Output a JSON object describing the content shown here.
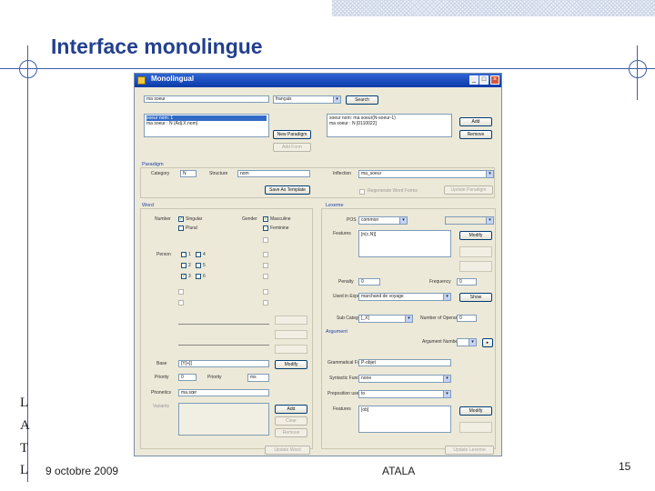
{
  "slide": {
    "title": "Interface monolingue",
    "date": "9 octobre 2009",
    "center": "ATALA",
    "page": "15",
    "side_letters": [
      "L",
      "A",
      "T",
      "L"
    ]
  },
  "window": {
    "title": "Monolingual",
    "min": "_",
    "max": "□",
    "close": "×"
  },
  "top": {
    "word_input": "ma soeur",
    "lang_select": "français",
    "search_btn": "Search",
    "list_left": [
      "soeur nom: 1",
      "ma soeur : N (Adj.X.nom)"
    ],
    "new_paradigm_btn": "New Paradigm",
    "add_form_btn": "Add Form",
    "list_right": [
      "soeur nom: ma soeur(N-soeur-1)",
      "ma soeur : N [0110022]"
    ],
    "add_btn": "Add",
    "remove_btn": "Remove"
  },
  "paradigm": {
    "header": "Paradigm",
    "category_label": "Category",
    "category_value": "N",
    "structure_label": "Structure",
    "structure_value": "nom",
    "save_btn": "Save As Template",
    "inflection_label": "Inflection",
    "inflection_value": "ma_soeur",
    "regenerate_label": "Regenerate Word Forms",
    "update_btn": "Update Paradigm"
  },
  "word": {
    "header": "Word",
    "number_label": "Number",
    "singular": "Singular",
    "plural": "Plural",
    "gender_label": "Gender",
    "masculine": "Masculine",
    "feminine": "Feminine",
    "person_label": "Person",
    "p1": "1",
    "p2": "2",
    "p3": "3",
    "p4": "4",
    "p5": "5",
    "p6": "6",
    "base_label": "Base",
    "base_value": "[Y[+]]",
    "priority_label": "Priority",
    "priority_value": "0",
    "priority_select": "ms",
    "modify_btn": "Modify",
    "phonetics_label": "Phonetics",
    "phonetics_value": "ma.sœr",
    "variants_label": "Variants",
    "add_btn": "Add",
    "clear_btn": "Clear",
    "remove_btn": "Remove",
    "update_btn": "Update Word"
  },
  "lexeme": {
    "header": "Lexeme",
    "pos_label": "POS",
    "pos_value": "common",
    "features_label": "Features",
    "features_value": "[n(c,N)]",
    "modify_btn": "Modify",
    "penalty_label": "Penalty",
    "penalty_value": "0",
    "frequency_label": "Frequency",
    "frequency_value": "0",
    "used_label": "Used in Expressions",
    "used_value": "marchand de voyage",
    "show_btn": "Show",
    "subcat_label": "Sub Category",
    "subcat_value": "[_X]",
    "number_ops_label": "Number of Operands",
    "number_ops_value": "0",
    "argument_header": "Argument",
    "arg_number_label": "Argument Number",
    "arg_number_value": "",
    "grammatical_label": "Grammatical Function",
    "grammatical_value": "P-objet",
    "syntactic_label": "Syntactic Function",
    "syntactic_value": "none",
    "preposition_label": "Preposition used",
    "preposition_value": "to",
    "arg_features_label": "Features",
    "arg_features_value": "[ob]",
    "modify2_btn": "Modify",
    "update_btn": "Update Lexeme"
  }
}
